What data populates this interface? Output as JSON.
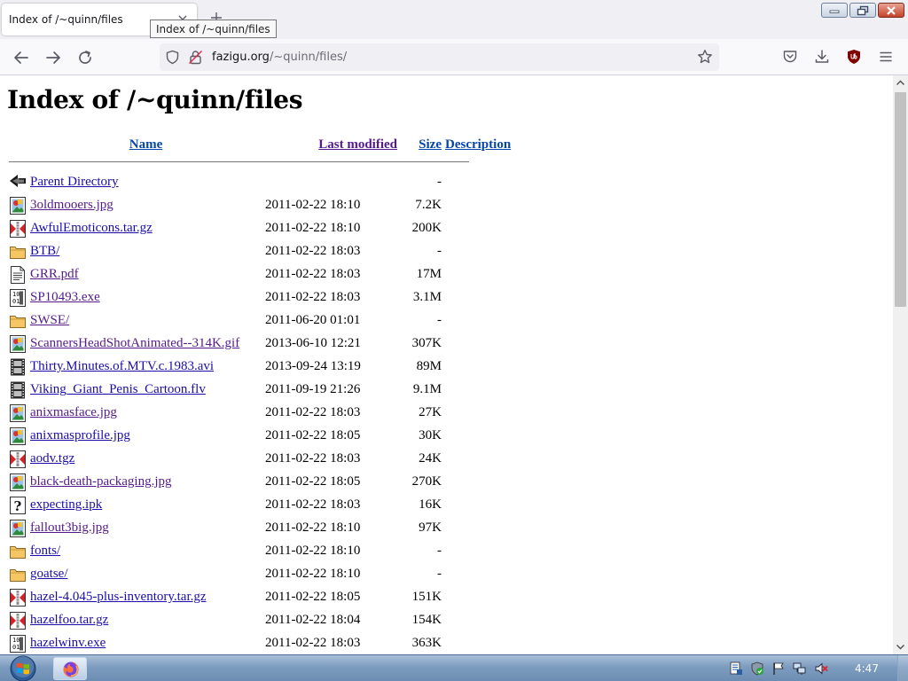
{
  "browser": {
    "tab_title": "Index of /~quinn/files",
    "tooltip": "Index of /~quinn/files",
    "url_host": "fazigu.org",
    "url_path": "/~quinn/files/"
  },
  "page": {
    "heading": "Index of /~quinn/files",
    "columns": {
      "name": "Name",
      "last_modified": "Last modified",
      "size": "Size",
      "description": "Description"
    },
    "rows": [
      {
        "icon": "back",
        "name": "Parent Directory",
        "modified": "",
        "size": "-",
        "visited": false
      },
      {
        "icon": "image",
        "name": "3oldmooers.jpg",
        "modified": "2011-02-22 18:10",
        "size": "7.2K",
        "visited": true
      },
      {
        "icon": "archive",
        "name": "AwfulEmoticons.tar.gz",
        "modified": "2011-02-22 18:10",
        "size": "200K",
        "visited": false
      },
      {
        "icon": "folder",
        "name": "BTB/",
        "modified": "2011-02-22 18:03",
        "size": "-",
        "visited": false
      },
      {
        "icon": "text",
        "name": "GRR.pdf",
        "modified": "2011-02-22 18:03",
        "size": "17M",
        "visited": true
      },
      {
        "icon": "binary",
        "name": "SP10493.exe",
        "modified": "2011-02-22 18:03",
        "size": "3.1M",
        "visited": true
      },
      {
        "icon": "folder",
        "name": "SWSE/",
        "modified": "2011-06-20 01:01",
        "size": "-",
        "visited": true
      },
      {
        "icon": "image",
        "name": "ScannersHeadShotAnimated--314K.gif",
        "modified": "2013-06-10 12:21",
        "size": "307K",
        "visited": true
      },
      {
        "icon": "movie",
        "name": "Thirty.Minutes.of.MTV.c.1983.avi",
        "modified": "2013-09-24 13:19",
        "size": "89M",
        "visited": false
      },
      {
        "icon": "movie",
        "name": "Viking_Giant_Penis_Cartoon.flv",
        "modified": "2011-09-19 21:26",
        "size": "9.1M",
        "visited": false
      },
      {
        "icon": "image",
        "name": "anixmasface.jpg",
        "modified": "2011-02-22 18:03",
        "size": "27K",
        "visited": true
      },
      {
        "icon": "image",
        "name": "anixmasprofile.jpg",
        "modified": "2011-02-22 18:05",
        "size": "30K",
        "visited": false
      },
      {
        "icon": "archive",
        "name": "aodv.tgz",
        "modified": "2011-02-22 18:03",
        "size": "24K",
        "visited": false
      },
      {
        "icon": "image",
        "name": "black-death-packaging.jpg",
        "modified": "2011-02-22 18:05",
        "size": "270K",
        "visited": true
      },
      {
        "icon": "unknown",
        "name": "expecting.ipk",
        "modified": "2011-02-22 18:03",
        "size": "16K",
        "visited": false
      },
      {
        "icon": "image",
        "name": "fallout3big.jpg",
        "modified": "2011-02-22 18:10",
        "size": "97K",
        "visited": true
      },
      {
        "icon": "folder",
        "name": "fonts/",
        "modified": "2011-02-22 18:10",
        "size": "-",
        "visited": false
      },
      {
        "icon": "folder",
        "name": "goatse/",
        "modified": "2011-02-22 18:10",
        "size": "-",
        "visited": false
      },
      {
        "icon": "archive",
        "name": "hazel-4.045-plus-inventory.tar.gz",
        "modified": "2011-02-22 18:05",
        "size": "151K",
        "visited": false
      },
      {
        "icon": "archive",
        "name": "hazelfoo.tar.gz",
        "modified": "2011-02-22 18:04",
        "size": "154K",
        "visited": false
      },
      {
        "icon": "binary",
        "name": "hazelwinv.exe",
        "modified": "2011-02-22 18:03",
        "size": "363K",
        "visited": false
      }
    ]
  },
  "taskbar": {
    "clock": "4:47"
  },
  "colors": {
    "link": "#1a0dab",
    "visited": "#551a8b",
    "taskbar": "#7d9cbf"
  }
}
